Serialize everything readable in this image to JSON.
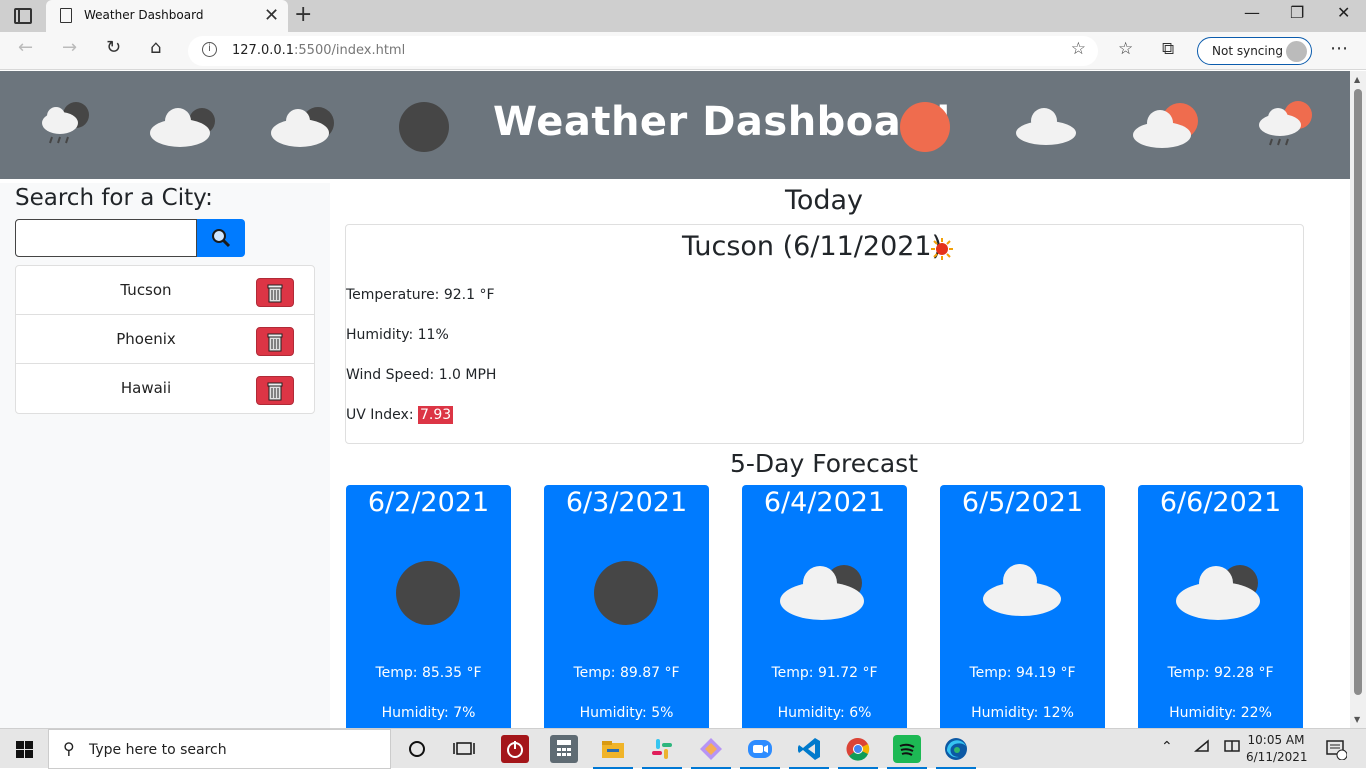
{
  "browser": {
    "tab_title": "Weather Dashboard",
    "url_host": "127.0.0.1",
    "url_rest": ":5500/index.html",
    "sync_label": "Not syncing"
  },
  "banner": {
    "title": "Weather Dashboard",
    "icons": [
      "rain-cloud-night-icon",
      "cloud-moon-icon",
      "cloud-moon-icon",
      "moon-icon",
      "sun-icon",
      "cloud-icon",
      "cloud-sun-icon",
      "rain-cloud-sun-icon"
    ]
  },
  "sidebar": {
    "heading": "Search for a City:",
    "search_placeholder": "",
    "cities": [
      {
        "name": "Tucson"
      },
      {
        "name": "Phoenix"
      },
      {
        "name": "Hawaii"
      }
    ]
  },
  "today": {
    "heading": "Today",
    "city_title": "Tucson (6/11/2021)",
    "temperature": "Temperature: 92.1 °F",
    "humidity": "Humidity: 11%",
    "wind": "Wind Speed: 1.0 MPH",
    "uv_label": "UV Index: ",
    "uv_value": "7.93"
  },
  "forecast": {
    "heading": "5-Day Forecast",
    "days": [
      {
        "date": "6/2/2021",
        "temp": "Temp: 85.35 °F",
        "humidity": "Humidity: 7%",
        "icon": "moon-icon"
      },
      {
        "date": "6/3/2021",
        "temp": "Temp: 89.87 °F",
        "humidity": "Humidity: 5%",
        "icon": "moon-icon"
      },
      {
        "date": "6/4/2021",
        "temp": "Temp: 91.72 °F",
        "humidity": "Humidity: 6%",
        "icon": "cloud-moon-icon"
      },
      {
        "date": "6/5/2021",
        "temp": "Temp: 94.19 °F",
        "humidity": "Humidity: 12%",
        "icon": "cloud-icon"
      },
      {
        "date": "6/6/2021",
        "temp": "Temp: 92.28 °F",
        "humidity": "Humidity: 22%",
        "icon": "cloud-moon-icon"
      }
    ]
  },
  "taskbar": {
    "search_placeholder": "Type here to search",
    "time": "10:05 AM",
    "date": "6/11/2021"
  },
  "colors": {
    "banner": "#6c757d",
    "primary": "#007bff",
    "danger": "#dc3545",
    "moon": "#464646",
    "sun": "#ef6c4e",
    "cloud": "#f2f2f2"
  }
}
